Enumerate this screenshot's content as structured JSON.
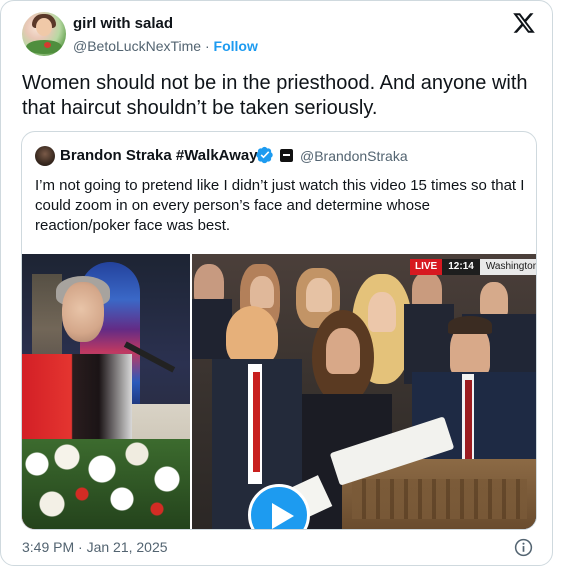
{
  "tweet": {
    "author_name": "girl with salad",
    "handle": "@BetoLuckNexTime",
    "separator": " · ",
    "follow_label": "Follow",
    "text": "Women should not be in the priesthood. And anyone with that haircut shouldn’t be taken seriously.",
    "timestamp": "3:49 PM · Jan 21, 2025"
  },
  "quote": {
    "author_name": "Brandon Straka #WalkAway",
    "handle": "@BrandonStraka",
    "text": "I’m not going to pretend like I didn’t just watch this video 15 times so that I could zoom in on every person’s face and determine whose reaction/poker face was best."
  },
  "video_overlay": {
    "live": "LIVE",
    "time": "12:14",
    "location": "Washington"
  },
  "icons": {
    "brand": "x-logo-icon",
    "verified": "verified-badge-icon",
    "play": "play-icon",
    "info": "info-icon"
  },
  "colors": {
    "accent": "#1d9bf0",
    "text": "#0f1419",
    "secondary": "#536471",
    "live_red": "#d71920"
  }
}
